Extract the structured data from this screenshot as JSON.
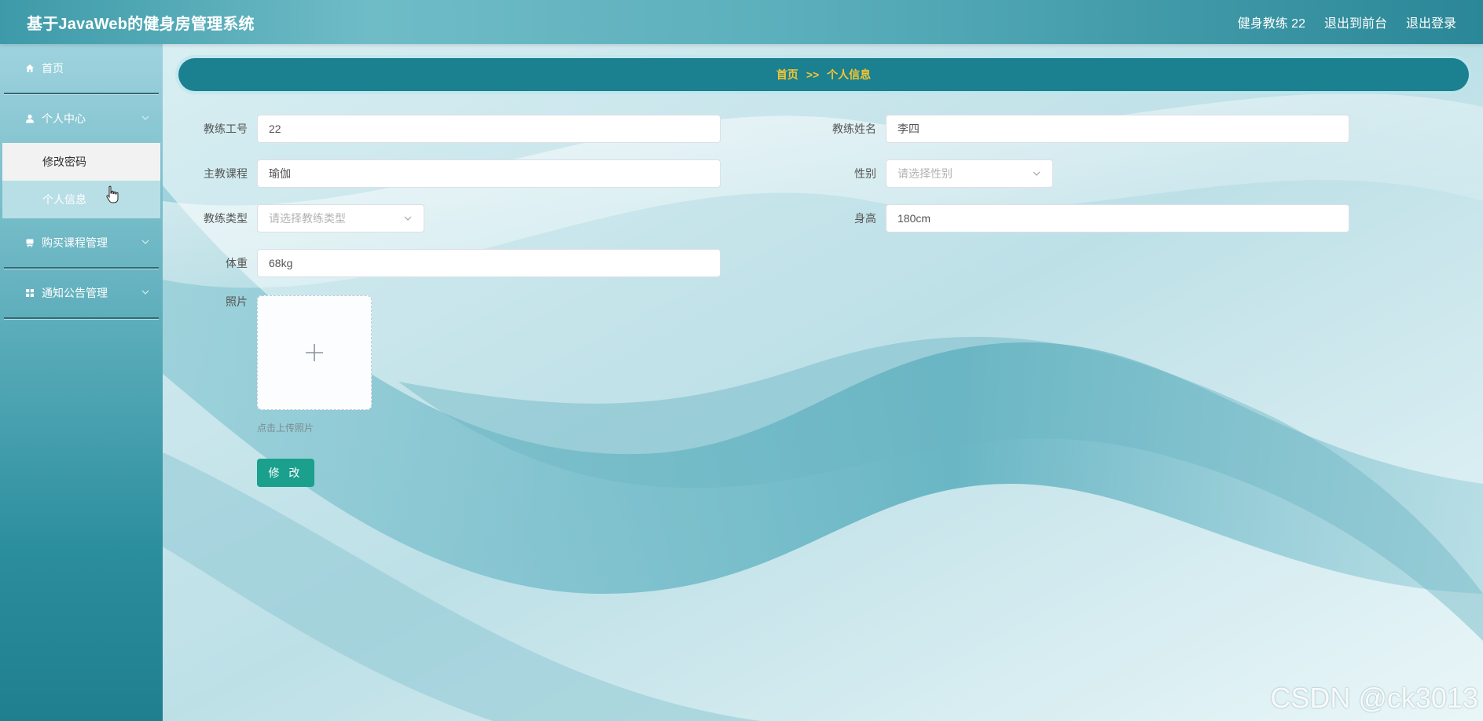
{
  "header": {
    "title": "基于JavaWeb的健身房管理系统",
    "user": "健身教练 22",
    "to_frontend": "退出到前台",
    "logout": "退出登录"
  },
  "sidebar": {
    "items": [
      {
        "label": "首页",
        "icon": "home-icon"
      },
      {
        "label": "个人中心",
        "icon": "user-icon",
        "children": [
          {
            "label": "修改密码"
          },
          {
            "label": "个人信息",
            "active": true
          }
        ]
      },
      {
        "label": "购买课程管理",
        "icon": "cart-icon"
      },
      {
        "label": "通知公告管理",
        "icon": "grid-icon"
      }
    ]
  },
  "breadcrumb": {
    "home": "首页",
    "separator": ">>",
    "current": "个人信息"
  },
  "form": {
    "coach_id": {
      "label": "教练工号",
      "value": "22"
    },
    "coach_name": {
      "label": "教练姓名",
      "value": "李四"
    },
    "main_course": {
      "label": "主教课程",
      "value": "瑜伽"
    },
    "gender": {
      "label": "性别",
      "placeholder": "请选择性别"
    },
    "coach_type": {
      "label": "教练类型",
      "placeholder": "请选择教练类型"
    },
    "height": {
      "label": "身高",
      "value": "180cm"
    },
    "weight": {
      "label": "体重",
      "value": "68kg"
    },
    "photo": {
      "label": "照片",
      "hint": "点击上传照片"
    },
    "submit_label": "修 改"
  },
  "watermark": "CSDN @ck3013",
  "colors": {
    "breadcrumb_bg": "#1b8090",
    "breadcrumb_text": "#f5c533",
    "button": "#1aa08d"
  }
}
